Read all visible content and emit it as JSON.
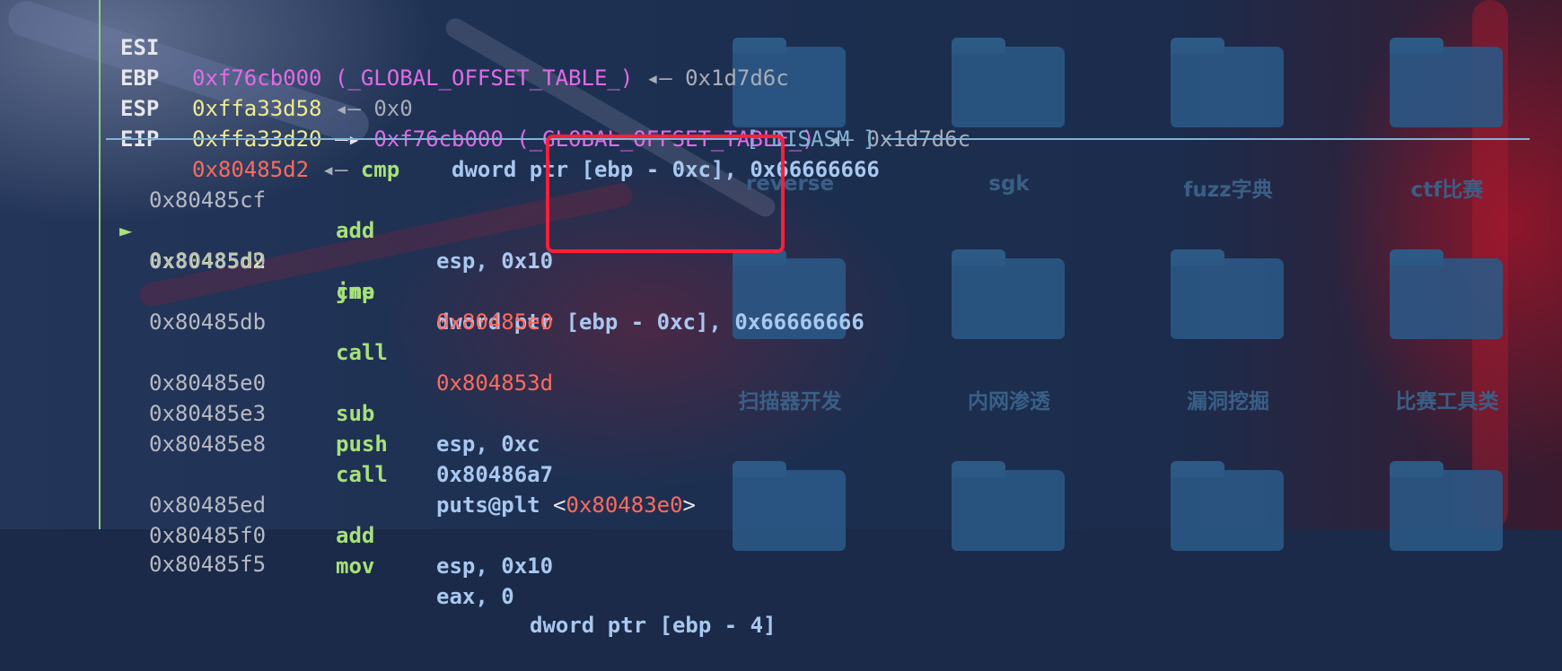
{
  "registers": [
    {
      "name": "ESI",
      "value": "0xf76cb000",
      "symbol": "(_GLOBAL_OFFSET_TABLE_)",
      "arrow": "◂—",
      "deref": "0x1d7d6c"
    },
    {
      "name": "EBP",
      "value": "0xffa33d58",
      "arrow": "◂—",
      "deref": "0x0"
    },
    {
      "name": "ESP",
      "value": "0xffa33d20",
      "arrow": "—▸",
      "target": "0xf76cb000",
      "symbol": "(_GLOBAL_OFFSET_TABLE_)",
      "arrow2": "◂—",
      "deref": "0x1d7d6c"
    },
    {
      "name": "EIP",
      "value": "0x80485d2",
      "arrow": "◂—",
      "mnemonic": "cmp",
      "operands": "dword ptr [ebp - 0xc], 0x66666666"
    }
  ],
  "disasm_label": "[ DISASM ]",
  "current_marker": "►",
  "instructions": [
    {
      "addr": "0x80485cf",
      "mnem": "add",
      "ops": "esp, 0x10"
    },
    {
      "addr": "0x80485d2",
      "mnem": "cmp",
      "ops": "dword ptr [ebp - 0xc], 0x66666666"
    },
    {
      "addr": "0x80485d9",
      "mnem": "jne",
      "ops": "0x80485e0"
    },
    {
      "addr": "0x80485db",
      "mnem": "call",
      "ops": "0x804853d"
    },
    {
      "addr": "0x80485e0",
      "mnem": "sub",
      "ops": "esp, 0xc"
    },
    {
      "addr": "0x80485e3",
      "mnem": "push",
      "ops": "0x80486a7"
    },
    {
      "addr": "0x80485e8",
      "mnem": "call",
      "ops": "puts@plt",
      "lt": "<",
      "target": "0x80483e0",
      "gt": ">"
    },
    {
      "addr": "0x80485ed",
      "mnem": "add",
      "ops": "esp, 0x10"
    },
    {
      "addr": "0x80485f0",
      "mnem": "mov",
      "ops": "eax, 0"
    },
    {
      "addr": "0x80485f5",
      "mnem": "",
      "ops": "dword ptr [ebp - 4]"
    }
  ],
  "desktop_icons": [
    {
      "label": "reverse"
    },
    {
      "label": "sgk"
    },
    {
      "label": "fuzz字典"
    },
    {
      "label": "ctf比赛"
    },
    {
      "label": "扫描器开发"
    },
    {
      "label": "内网渗透"
    },
    {
      "label": "漏洞挖掘"
    },
    {
      "label": "比赛工具类"
    },
    {
      "label": ""
    },
    {
      "label": ""
    },
    {
      "label": ""
    },
    {
      "label": ""
    }
  ],
  "colors": {
    "background": "#1a2a48",
    "highlight_box": "#ff1e38",
    "divider": "#7fb4d8",
    "address": "#ff6b5e",
    "symbol": "#e06ce8",
    "register_value": "#f0eb8f",
    "mnemonic": "#a7e17a",
    "operand": "#a9c8f0"
  }
}
